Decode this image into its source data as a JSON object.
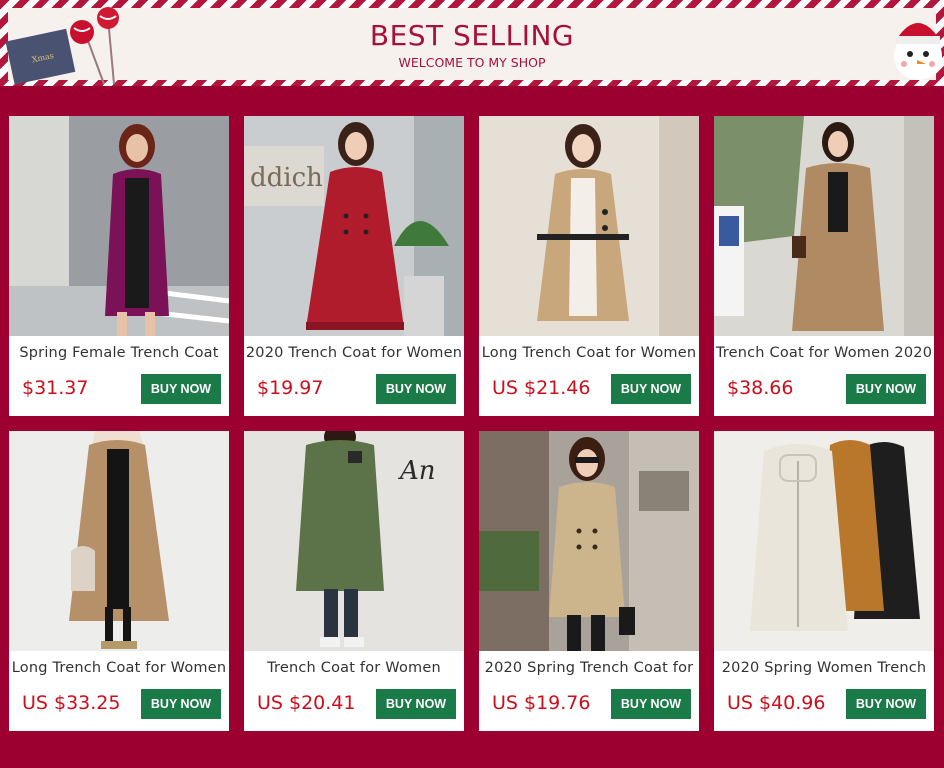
{
  "banner": {
    "title": "BEST SELLING",
    "subtitle": "WELCOME TO MY SHOP",
    "card_text": "Xmas"
  },
  "colors": {
    "page_background": "#9c0030",
    "accent": "#a6113a",
    "price": "#cc0f1b",
    "button": "#1a7a48"
  },
  "products": [
    {
      "title": "Spring Female Trench Coat",
      "price": "$31.37",
      "button_label": "BUY NOW",
      "coat_color": "#7b1257",
      "bg_color": "#9a9ea3"
    },
    {
      "title": "2020 Trench Coat for Women",
      "price": "$19.97",
      "button_label": "BUY NOW",
      "coat_color": "#b01c2c",
      "bg_color": "#c9cdd0"
    },
    {
      "title": "Long Trench Coat for Women",
      "price": "US $21.46",
      "button_label": "BUY NOW",
      "coat_color": "#c9a77c",
      "bg_color": "#e6dfd6"
    },
    {
      "title": "Trench Coat for Women 2020",
      "price": "$38.66",
      "button_label": "BUY NOW",
      "coat_color": "#b08a62",
      "bg_color": "#dad8d2"
    },
    {
      "title": "Long Trench Coat for Women",
      "price": "US $33.25",
      "button_label": "BUY NOW",
      "coat_color": "#b69069",
      "bg_color": "#ededeb"
    },
    {
      "title": "Trench Coat for Women",
      "price": "US $20.41",
      "button_label": "BUY NOW",
      "coat_color": "#5c7248",
      "bg_color": "#e5e3e0"
    },
    {
      "title": "2020 Spring Trench Coat for",
      "price": "US $19.76",
      "button_label": "BUY NOW",
      "coat_color": "#ccb48c",
      "bg_color": "#a8a29a"
    },
    {
      "title": "2020 Spring Women Trench",
      "price": "US $40.96",
      "button_label": "BUY NOW",
      "coat_color": "#e9e5da",
      "bg_color": "#f0eeea"
    }
  ]
}
